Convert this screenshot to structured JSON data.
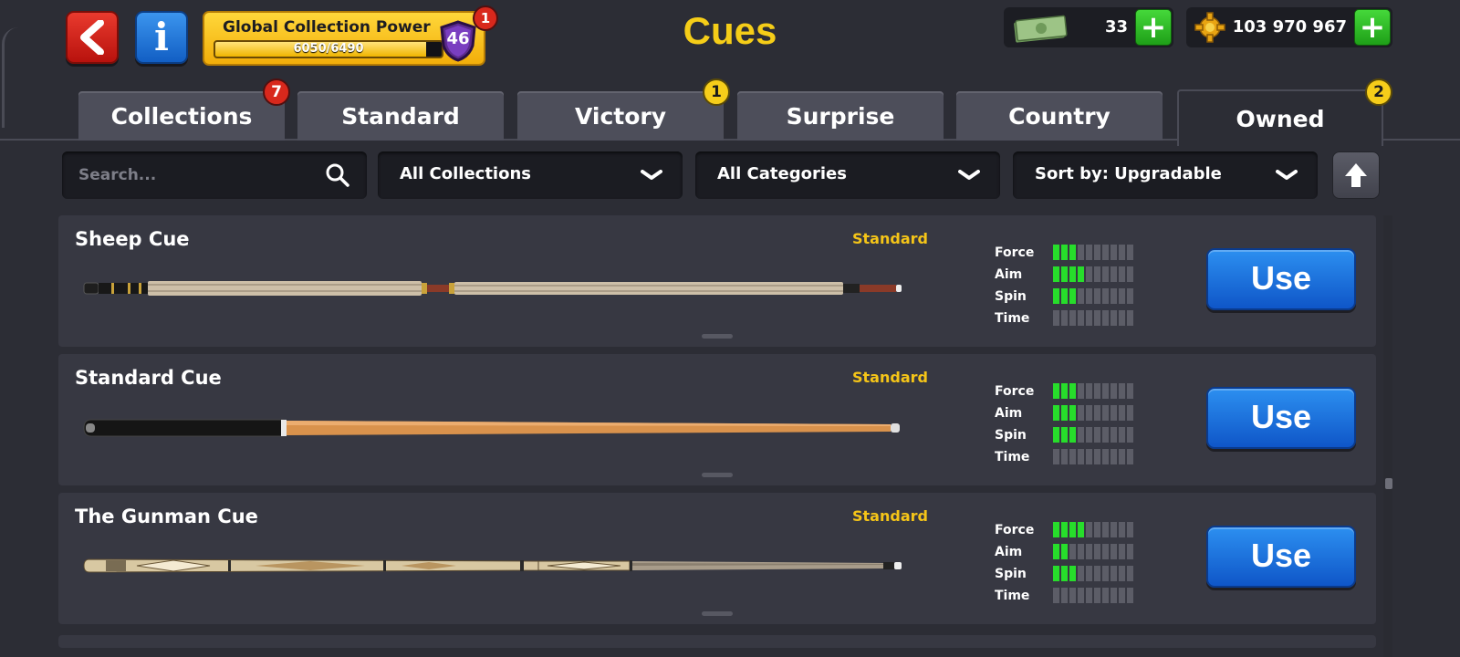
{
  "header": {
    "title": "Cues",
    "back_icon": "back-arrow-icon",
    "info_icon": "info-icon",
    "info_label": "i",
    "collection_power": {
      "label": "Global Collection Power",
      "progress_text": "6050/6490",
      "progress": 0.932,
      "level": "46",
      "notification": "1"
    },
    "currencies": [
      {
        "name": "cash",
        "icon": "cash-icon",
        "amount": "33",
        "add_label": "+"
      },
      {
        "name": "coins",
        "icon": "coins-icon",
        "amount": "103 970 967",
        "add_label": "+"
      }
    ]
  },
  "tabs": [
    {
      "label": "Collections",
      "badge": "7",
      "badge_color": "red"
    },
    {
      "label": "Standard",
      "badge": ""
    },
    {
      "label": "Victory",
      "badge": "1",
      "badge_color": "yellow"
    },
    {
      "label": "Surprise",
      "badge": ""
    },
    {
      "label": "Country",
      "badge": ""
    },
    {
      "label": "Owned",
      "badge": "2",
      "badge_color": "yellow",
      "active": true
    }
  ],
  "filters": {
    "search_placeholder": "Search...",
    "collection": "All Collections",
    "category": "All Categories",
    "sort": "Sort by: Upgradable",
    "sort_direction_icon": "arrow-up-icon"
  },
  "stat_labels": [
    "Force",
    "Aim",
    "Spin",
    "Time"
  ],
  "stat_max": 10,
  "cues": [
    {
      "name": "Sheep Cue",
      "category": "Standard",
      "stats": {
        "force": 3,
        "aim": 4,
        "spin": 3,
        "time": 0
      },
      "action": "Use"
    },
    {
      "name": "Standard Cue",
      "category": "Standard",
      "stats": {
        "force": 3,
        "aim": 3,
        "spin": 3,
        "time": 0
      },
      "action": "Use"
    },
    {
      "name": "The Gunman Cue",
      "category": "Standard",
      "stats": {
        "force": 4,
        "aim": 2,
        "spin": 3,
        "time": 0
      },
      "action": "Use"
    }
  ],
  "colors": {
    "background": "#2c2d35",
    "accent_yellow": "#f5cd18",
    "stat_on": "#27dd2b",
    "use_button": "#1b6fdd",
    "badge_red": "#d8281c",
    "badge_yellow": "#f6cd1a"
  }
}
